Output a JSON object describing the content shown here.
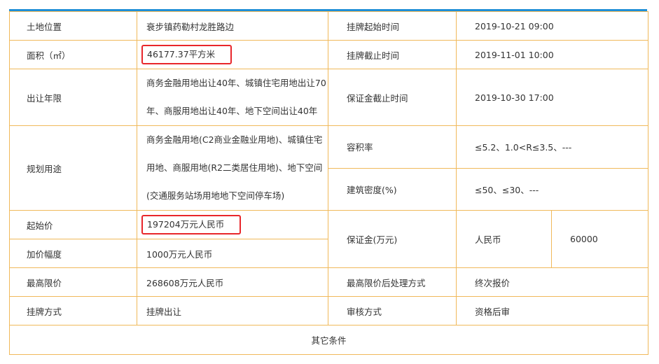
{
  "colors": {
    "accent_bar": "#1f8fd6",
    "border": "#f0b95a",
    "highlight": "#e8262b"
  },
  "rows": {
    "location": {
      "label": "土地位置",
      "value": "衰步镇药勒村龙胜路边"
    },
    "area": {
      "label": "面积（㎡）",
      "value": "46177.37平方米"
    },
    "term": {
      "label": "出让年限",
      "line1": "商务金融用地出让40年、城镇住宅用地出让70",
      "line2": "年、商服用地出让40年、地下空间出让40年"
    },
    "usage": {
      "label": "规划用途",
      "line1": "商务金融用地(C2商业金融业用地)、城镇住宅",
      "line2": "用地、商服用地(R2二类居住用地)、地下空间",
      "line3": "(交通服务站场用地地下空间停车场)"
    },
    "start_price": {
      "label": "起始价",
      "value": "197204万元人民币"
    },
    "increment": {
      "label": "加价幅度",
      "value": "1000万元人民币"
    },
    "max_price": {
      "label": "最高限价",
      "value": "268608万元人民币"
    },
    "method": {
      "label": "挂牌方式",
      "value": "挂牌出让"
    },
    "listing_start": {
      "label": "挂牌起始时间",
      "value": "2019-10-21 09:00"
    },
    "listing_end": {
      "label": "挂牌截止时间",
      "value": "2019-11-01 10:00"
    },
    "deposit_deadline": {
      "label": "保证金截止时间",
      "value": "2019-10-30 17:00"
    },
    "plot_ratio": {
      "label": "容积率",
      "value": "≤5.2、1.0<R≤3.5、---"
    },
    "density": {
      "label": "建筑密度(%)",
      "value": "≤50、≤30、---"
    },
    "deposit": {
      "label": "保证金(万元)",
      "currency": "人民币",
      "amount": "60000"
    },
    "max_handling": {
      "label": "最高限价后处理方式",
      "value": "终次报价"
    },
    "review": {
      "label": "审核方式",
      "value": "资格后审"
    },
    "other": {
      "label": "其它条件"
    }
  }
}
